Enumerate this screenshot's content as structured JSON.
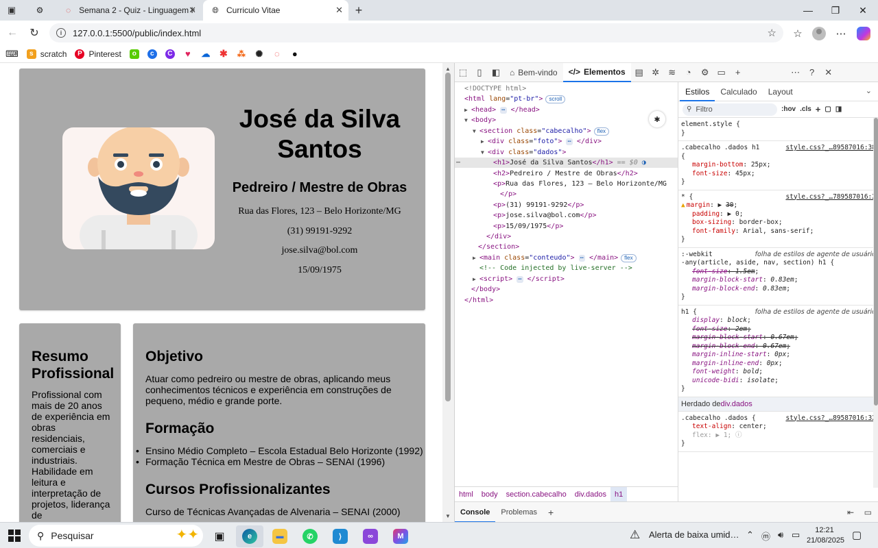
{
  "browser": {
    "tabs": [
      {
        "title": "",
        "favicon": "gear-icon"
      },
      {
        "title": "Semana 2 - Quiz - Linguagem HT",
        "favicon": "loading-ring-icon"
      },
      {
        "title": "Curriculo Vitae",
        "favicon": "globe-icon"
      }
    ],
    "url": "127.0.0.1:5500/public/index.html",
    "bookmarks": [
      {
        "label": "scratch",
        "color": "#f2a01d"
      },
      {
        "label": "Pinterest",
        "color": "#e60023"
      }
    ]
  },
  "page": {
    "name": "José da Silva Santos",
    "role": "Pedreiro / Mestre de Obras",
    "address": "Rua das Flores, 123 – Belo Horizonte/MG",
    "phone": "(31) 99191-9292",
    "email": "jose.silva@bol.com",
    "birth": "15/09/1975",
    "resumo": {
      "title": "Resumo Profissional",
      "text": "Profissional com mais de 20 anos de experiência em obras residenciais, comerciais e industriais. Habilidade em leitura e interpretação de projetos, liderança de"
    },
    "objetivo": {
      "title": "Objetivo",
      "text": "Atuar como pedreiro ou mestre de obras, aplicando meus conhecimentos técnicos e experiência em construções de pequeno, médio e grande porte."
    },
    "formacao": {
      "title": "Formação",
      "items": [
        "Ensino Médio Completo – Escola Estadual Belo Horizonte (1992)",
        "Formação Técnica em Mestre de Obras – SENAI (1996)"
      ]
    },
    "cursos": {
      "title": "Cursos Profissionalizantes",
      "first_item": "Curso de Técnicas Avançadas de Alvenaria – SENAI (2000)"
    }
  },
  "devtools": {
    "tabs": {
      "welcome": "Bem-vindo",
      "elements": "Elementos"
    },
    "dom": {
      "doctype": "<!DOCTYPE html>",
      "html_lang": "pt-br",
      "scroll_pill": "scroll",
      "flex_pill": "flex",
      "section_class": "cabecalho",
      "foto_class": "foto",
      "dados_class": "dados",
      "h1_text": "José da Silva Santos",
      "dollar_zero": "== $0",
      "h2_text": "Pedreiro / Mestre de Obras",
      "p1_text": "Rua das Flores, 123 – Belo Horizonte/MG",
      "p2_text": "(31) 99191-9292",
      "p3_text": "jose.silva@bol.com",
      "p4_text": "15/09/1975",
      "main_class": "conteudo",
      "comment": "<!-- Code injected by live-server -->"
    },
    "breadcrumbs": [
      "html",
      "body",
      "section.cabecalho",
      "div.dados",
      "h1"
    ],
    "drawer": {
      "console": "Console",
      "issues": "Problemas"
    },
    "styles": {
      "tabs": [
        "Estilos",
        "Calculado",
        "Layout"
      ],
      "filter_placeholder": "Filtro",
      "hov": ":hov",
      "cls": ".cls",
      "element_style": "element.style {",
      "rule1": {
        "selector": ".cabecalho .dados h1",
        "source": "style.css?_…89587016:38",
        "decls": [
          [
            "margin-bottom",
            "25px"
          ],
          [
            "font-size",
            "45px"
          ]
        ]
      },
      "rule2": {
        "selector": "* {",
        "source": "style.css?_…789587016:2",
        "margin": "margin",
        "margin_val": "30",
        "padding": "padding",
        "padding_val": "0",
        "boxsizing": "box-sizing",
        "boxsizing_val": "border-box",
        "fontfamily": "font-family",
        "fontfamily_val": "Arial, sans-serif"
      },
      "ua_label": "folha de estilos de agente de usuário",
      "rule3": {
        "selector_l1": ":-webkit",
        "selector_l2": "-any(article, aside, nav, section) h1 {",
        "decls": [
          [
            "font-size",
            "1.5em"
          ],
          [
            "margin-block-start",
            "0.83em"
          ],
          [
            "margin-block-end",
            "0.83em"
          ]
        ]
      },
      "rule4": {
        "selector": "h1 {",
        "decls": [
          [
            "display",
            "block"
          ],
          [
            "font-size",
            "2em"
          ],
          [
            "margin-block-start",
            "0.67em"
          ],
          [
            "margin-block-end",
            "0.67em"
          ],
          [
            "margin-inline-start",
            "0px"
          ],
          [
            "margin-inline-end",
            "0px"
          ],
          [
            "font-weight",
            "bold"
          ],
          [
            "unicode-bidi",
            "isolate"
          ]
        ]
      },
      "inherited_prefix": "Herdado de",
      "inherited_tag": "div.dados",
      "rule5": {
        "selector": ".cabecalho .dados {",
        "source": "style.css?_…89587016:32",
        "decls": [
          [
            "text-align",
            "center"
          ],
          [
            "flex",
            "1"
          ]
        ]
      }
    }
  },
  "taskbar": {
    "search_placeholder": "Pesquisar",
    "alert": "Alerta de baixa umid…",
    "time": "12:21",
    "date": "21/08/2025"
  }
}
